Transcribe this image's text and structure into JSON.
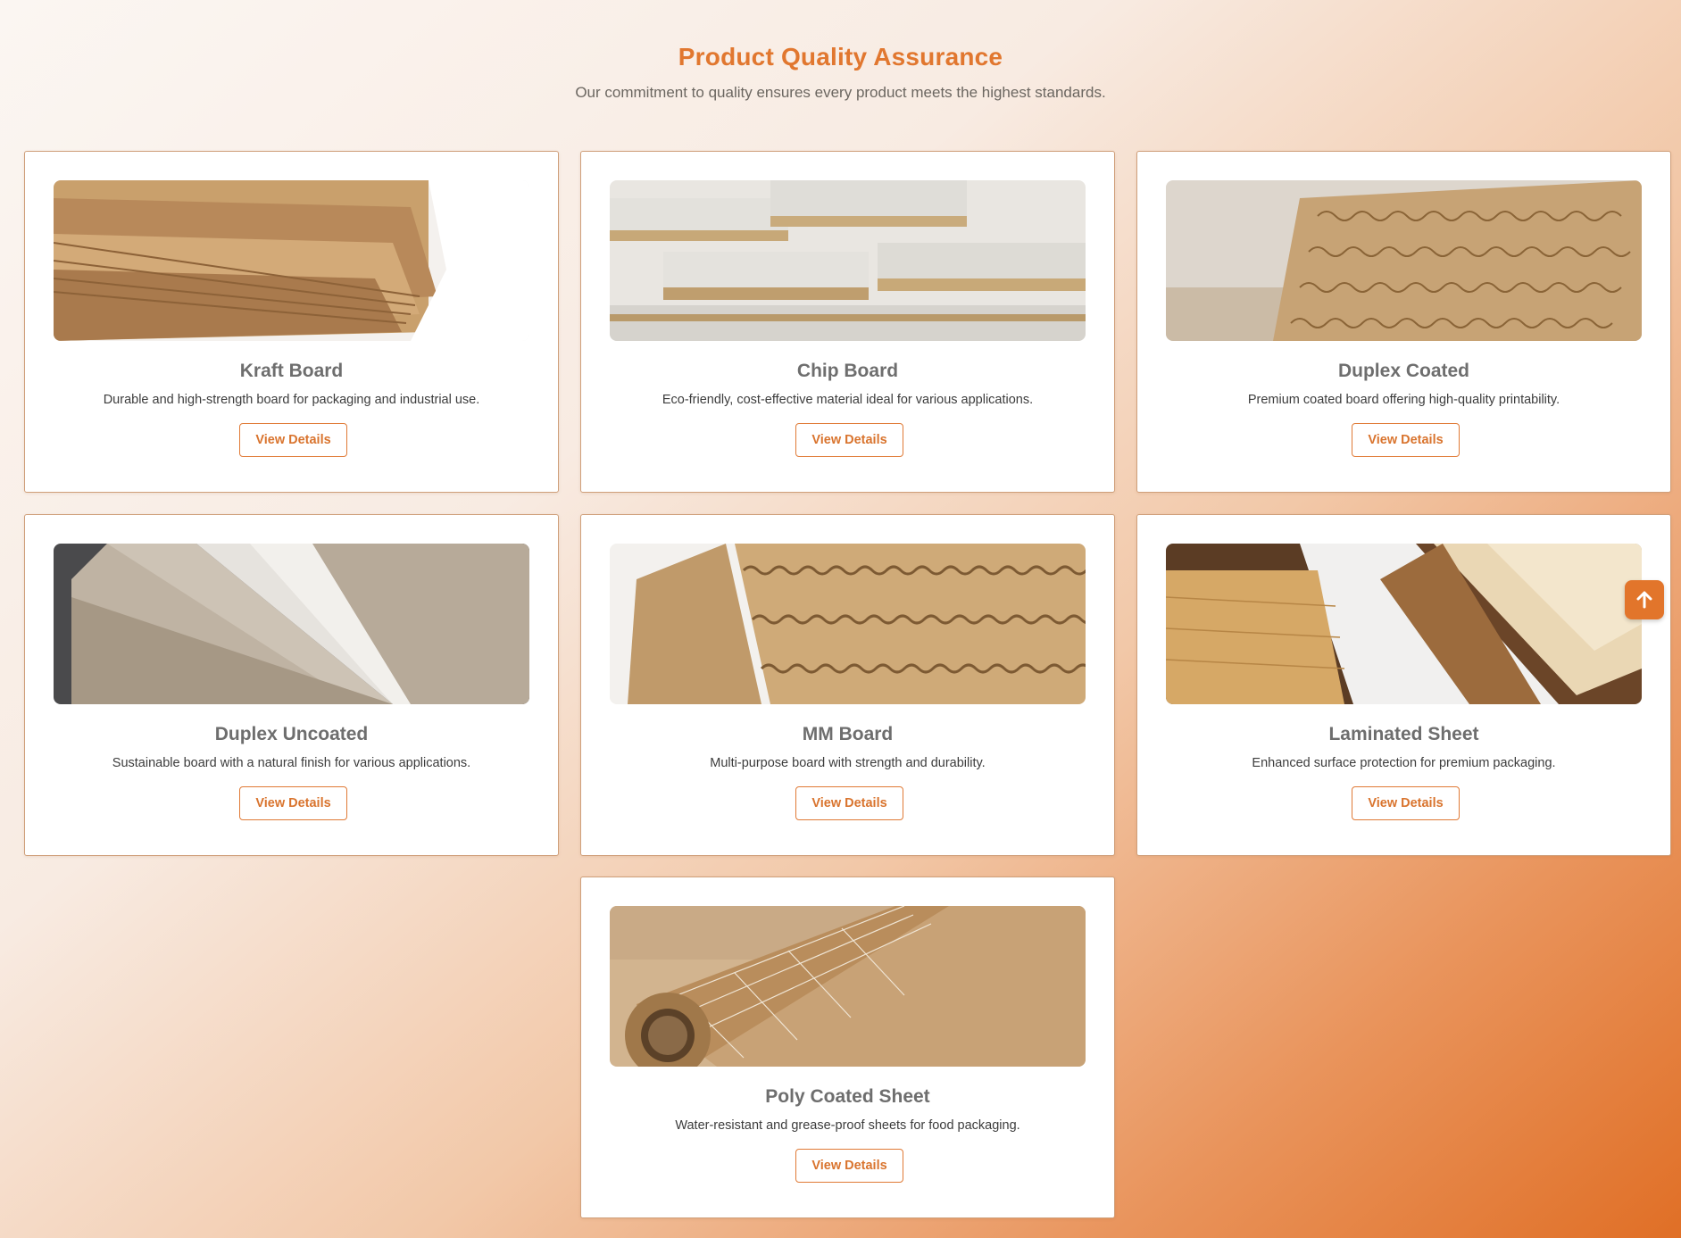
{
  "section": {
    "title": "Product Quality Assurance",
    "subtitle": "Our commitment to quality ensures every product meets the highest standards."
  },
  "products": [
    {
      "name": "Kraft Board",
      "description": "Durable and high-strength board for packaging and industrial use.",
      "button_label": "View Details",
      "image": "kraft-board-image"
    },
    {
      "name": "Chip Board",
      "description": "Eco-friendly, cost-effective material ideal for various applications.",
      "button_label": "View Details",
      "image": "chip-board-image"
    },
    {
      "name": "Duplex Coated",
      "description": "Premium coated board offering high-quality printability.",
      "button_label": "View Details",
      "image": "duplex-coated-image"
    },
    {
      "name": "Duplex Uncoated",
      "description": "Sustainable board with a natural finish for various applications.",
      "button_label": "View Details",
      "image": "duplex-uncoated-image"
    },
    {
      "name": "MM Board",
      "description": "Multi-purpose board with strength and durability.",
      "button_label": "View Details",
      "image": "mm-board-image"
    },
    {
      "name": "Laminated Sheet",
      "description": "Enhanced surface protection for premium packaging.",
      "button_label": "View Details",
      "image": "laminated-sheet-image"
    },
    {
      "name": "Poly Coated Sheet",
      "description": "Water-resistant and grease-proof sheets for food packaging.",
      "button_label": "View Details",
      "image": "poly-coated-sheet-image"
    }
  ],
  "scroll_top": {
    "icon": "arrow-up-icon"
  },
  "colors": {
    "accent": "#e1772f",
    "card_border": "#cf9f7a"
  }
}
